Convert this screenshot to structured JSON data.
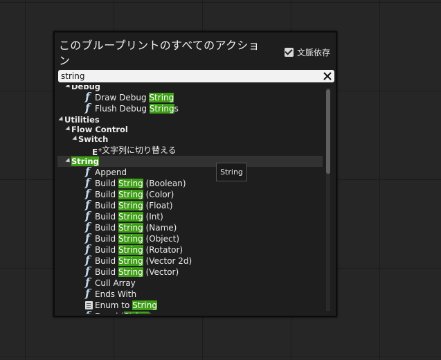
{
  "panel": {
    "title": "このブループリントのすべてのアクション",
    "context_sensitive_label": "文脈依存",
    "context_sensitive_checked": true,
    "search_value": "string",
    "clear_icon": "close-icon"
  },
  "tooltip": "String",
  "scroll_position": 0.0,
  "tree": [
    {
      "type": "category",
      "depth": 0,
      "label": "Debug",
      "segments": [
        {
          "t": "Debug"
        }
      ]
    },
    {
      "type": "function",
      "depth": 2,
      "icon": "function-icon",
      "segments": [
        {
          "t": "Draw Debug "
        },
        {
          "t": "String",
          "hl": true
        }
      ]
    },
    {
      "type": "function",
      "depth": 2,
      "icon": "function-icon",
      "segments": [
        {
          "t": "Flush Debug "
        },
        {
          "t": "String",
          "hl": true
        },
        {
          "t": "s"
        }
      ]
    },
    {
      "type": "category",
      "depth": -1,
      "segments": [
        {
          "t": "Utilities"
        }
      ]
    },
    {
      "type": "category",
      "depth": 0,
      "segments": [
        {
          "t": "Flow Control"
        }
      ]
    },
    {
      "type": "category",
      "depth": 1,
      "segments": [
        {
          "t": "Switch"
        }
      ]
    },
    {
      "type": "macro",
      "depth": 3,
      "icon": "switch-macro-icon",
      "segments": [
        {
          "t": "文字列に切り替える"
        }
      ]
    },
    {
      "type": "category",
      "depth": 0,
      "selected": true,
      "segments": [
        {
          "t": "String",
          "hl": true
        }
      ]
    },
    {
      "type": "function",
      "depth": 2,
      "icon": "function-icon",
      "segments": [
        {
          "t": "Append"
        }
      ]
    },
    {
      "type": "function",
      "depth": 2,
      "icon": "function-icon",
      "segments": [
        {
          "t": "Build "
        },
        {
          "t": "String",
          "hl": true
        },
        {
          "t": " (Boolean)"
        }
      ]
    },
    {
      "type": "function",
      "depth": 2,
      "icon": "function-icon",
      "segments": [
        {
          "t": "Build "
        },
        {
          "t": "String",
          "hl": true
        },
        {
          "t": " (Color)"
        }
      ]
    },
    {
      "type": "function",
      "depth": 2,
      "icon": "function-icon",
      "segments": [
        {
          "t": "Build "
        },
        {
          "t": "String",
          "hl": true
        },
        {
          "t": " (Float)"
        }
      ]
    },
    {
      "type": "function",
      "depth": 2,
      "icon": "function-icon",
      "segments": [
        {
          "t": "Build "
        },
        {
          "t": "String",
          "hl": true
        },
        {
          "t": " (Int)"
        }
      ]
    },
    {
      "type": "function",
      "depth": 2,
      "icon": "function-icon",
      "segments": [
        {
          "t": "Build "
        },
        {
          "t": "String",
          "hl": true
        },
        {
          "t": " (Name)"
        }
      ]
    },
    {
      "type": "function",
      "depth": 2,
      "icon": "function-icon",
      "segments": [
        {
          "t": "Build "
        },
        {
          "t": "String",
          "hl": true
        },
        {
          "t": " (Object)"
        }
      ]
    },
    {
      "type": "function",
      "depth": 2,
      "icon": "function-icon",
      "segments": [
        {
          "t": "Build "
        },
        {
          "t": "String",
          "hl": true
        },
        {
          "t": " (Rotator)"
        }
      ]
    },
    {
      "type": "function",
      "depth": 2,
      "icon": "function-icon",
      "segments": [
        {
          "t": "Build "
        },
        {
          "t": "String",
          "hl": true
        },
        {
          "t": " (Vector 2d)"
        }
      ]
    },
    {
      "type": "function",
      "depth": 2,
      "icon": "function-icon",
      "segments": [
        {
          "t": "Build "
        },
        {
          "t": "String",
          "hl": true
        },
        {
          "t": " (Vector)"
        }
      ]
    },
    {
      "type": "function",
      "depth": 2,
      "icon": "function-icon",
      "segments": [
        {
          "t": "Cull Array"
        }
      ]
    },
    {
      "type": "function",
      "depth": 2,
      "icon": "function-icon",
      "segments": [
        {
          "t": "Ends With"
        }
      ]
    },
    {
      "type": "function",
      "depth": 2,
      "icon": "conversion-doc-icon",
      "segments": [
        {
          "t": "Enum to "
        },
        {
          "t": "String",
          "hl": true
        }
      ]
    },
    {
      "type": "function",
      "depth": 2,
      "icon": "function-icon",
      "segments": [
        {
          "t": "Equal ("
        },
        {
          "t": "String",
          "hl": true
        },
        {
          "t": ")"
        }
      ]
    }
  ]
}
